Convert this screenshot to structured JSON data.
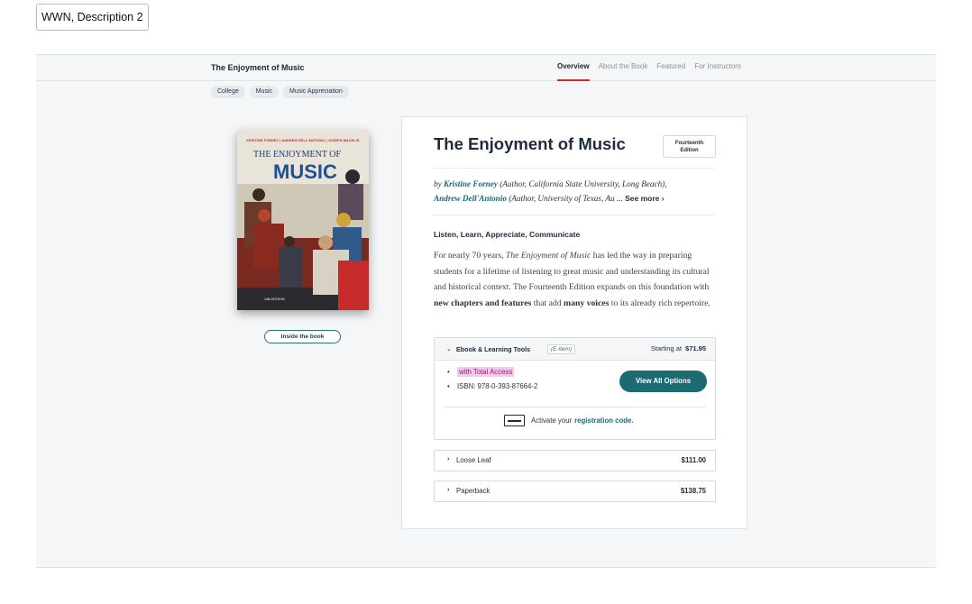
{
  "window": {
    "title": "WWN, Description 2"
  },
  "topbar": {
    "book_title": "The Enjoyment of Music",
    "tabs": [
      {
        "label": "Overview",
        "active": true
      },
      {
        "label": "About the Book",
        "active": false
      },
      {
        "label": "Featured",
        "active": false
      },
      {
        "label": "For Instructors",
        "active": false
      }
    ]
  },
  "breadcrumbs": [
    "College",
    "Music",
    "Music Appreciation"
  ],
  "cover": {
    "authors": "KRISTINE FORNEY | ANDREW DELL'ANTONIO | JOSEPH MACHLIS",
    "title_line1": "THE ENJOYMENT OF",
    "title_line2": "MUSIC",
    "edition": "14th EDITION"
  },
  "inside_book_label": "Inside the book",
  "book": {
    "title": "The Enjoyment of Music",
    "edition_badge_line1": "Fourteenth",
    "edition_badge_line2": "Edition",
    "by": "by",
    "author1_name": "Kristine Forney",
    "author1_role": "(Author, California State University, Long Beach),",
    "author2_name": "Andrew Dell'Antonio",
    "author2_role": "(Author, University of Texas, Au ...",
    "see_more": "See more",
    "tagline": "Listen, Learn, Appreciate, Communicate",
    "desc_part1": "For nearly 70 years, ",
    "desc_italic": "The Enjoyment of Music",
    "desc_part2": " has led the way in preparing students for a lifetime of listening to great music and understanding its cultural and historical context. The Fourteenth Edition expands on this foundation with ",
    "desc_bold1": "new chapters and features",
    "desc_part3": " that add ",
    "desc_bold2": "many voices",
    "desc_part4": " to its already rich repertoire."
  },
  "formats": {
    "ebook": {
      "name": "Ebook & Learning Tools",
      "tag": "(E-item)",
      "starting_label": "Starting at",
      "starting_price": "$71.95",
      "bullet1": "with Total Access",
      "bullet2": "ISBN: 978-0-393-87664-2",
      "view_all": "View All Options",
      "activate_text": "Activate your",
      "activate_link": "registration code."
    },
    "rows": [
      {
        "name": "Loose Leaf",
        "price": "$111.00"
      },
      {
        "name": "Paperback",
        "price": "$138.75"
      }
    ]
  }
}
